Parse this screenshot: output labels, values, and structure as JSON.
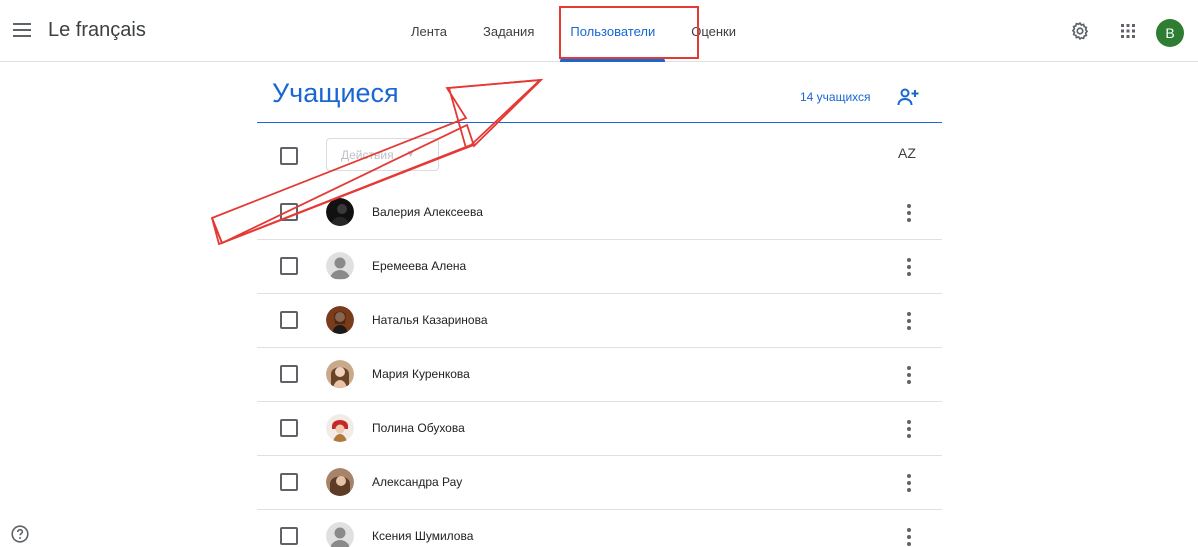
{
  "app": {
    "title": "Le français",
    "avatar_letter": "B",
    "avatar_color": "#2e7d32"
  },
  "tabs": [
    {
      "label": "Лента"
    },
    {
      "label": "Задания"
    },
    {
      "label": "Пользователи",
      "active": true
    },
    {
      "label": "Оценки"
    }
  ],
  "students": {
    "title": "Учащиеся",
    "count_label": "14 учащихся",
    "actions_label": "Действия",
    "sort_label": "AZ",
    "items": [
      {
        "name": "Валерия Алексеева",
        "avatar": "photo-dark"
      },
      {
        "name": "Еремеева Алена",
        "avatar": "default-person"
      },
      {
        "name": "Наталья Казаринова",
        "avatar": "photo-brown"
      },
      {
        "name": "Мария Куренкова",
        "avatar": "photo-light"
      },
      {
        "name": "Полина Обухова",
        "avatar": "photo-red-hat"
      },
      {
        "name": "Александра Рау",
        "avatar": "photo-tan"
      },
      {
        "name": "Ксения Шумилова",
        "avatar": "default-person"
      }
    ]
  },
  "colors": {
    "accent": "#1967d2",
    "annotation": "#e53935"
  }
}
